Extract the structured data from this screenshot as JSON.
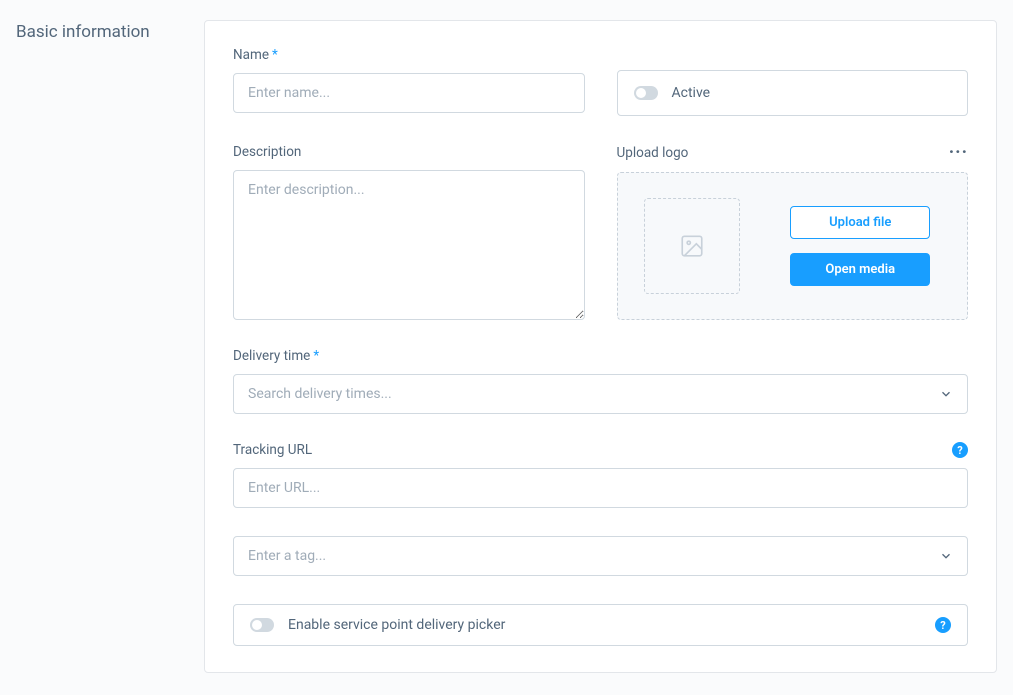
{
  "side_title": "Basic information",
  "name": {
    "label": "Name",
    "placeholder": "Enter name..."
  },
  "active": {
    "label": "Active"
  },
  "description": {
    "label": "Description",
    "placeholder": "Enter description..."
  },
  "upload": {
    "label": "Upload logo",
    "upload_btn": "Upload file",
    "media_btn": "Open media"
  },
  "delivery_time": {
    "label": "Delivery time",
    "placeholder": "Search delivery times..."
  },
  "tracking": {
    "label": "Tracking URL",
    "placeholder": "Enter URL..."
  },
  "tag": {
    "placeholder": "Enter a tag..."
  },
  "service_point": {
    "label": "Enable service point delivery picker"
  }
}
